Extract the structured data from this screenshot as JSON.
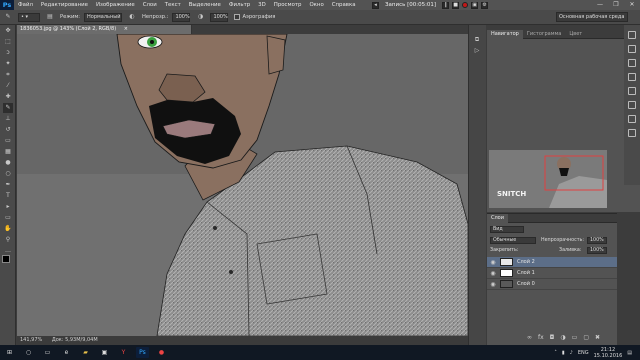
{
  "app": {
    "logo": "Ps"
  },
  "menu": [
    "Файл",
    "Редактирование",
    "Изображение",
    "Слои",
    "Текст",
    "Выделение",
    "Фильтр",
    "3D",
    "Просмотр",
    "Окно",
    "Справка"
  ],
  "recorder": {
    "label": "Запись [00:05:01]"
  },
  "window_controls": {
    "minimize": "—",
    "restore": "❐",
    "close": "✕"
  },
  "options": {
    "mode_label": "Режим:",
    "mode_value": "Нормальный",
    "opacity_label": "Непрозр.:",
    "opacity_value": "100%",
    "flow_value": "100%",
    "airbrush_label": "Аэрография",
    "workspace": "Основная рабочая среда"
  },
  "document": {
    "tab_title": "1836053.jpg @ 143% (Слой 2, RGB/8)",
    "close": "×",
    "status_zoom": "141,97%",
    "status_doc": "Док: 5,93M/9,04M"
  },
  "navigator": {
    "tabs": [
      "Навигатор",
      "Гистограмма",
      "Цвет"
    ],
    "thumb_text": "SNITCH",
    "zoom": "141,97%"
  },
  "layers": {
    "tabs": [
      "Слои"
    ],
    "kind_label": "Вид",
    "blend_mode": "Обычные",
    "opacity_label": "Непрозрачность:",
    "opacity_value": "100%",
    "lock_label": "Закрепить:",
    "fill_label": "Заливка:",
    "fill_value": "100%",
    "items": [
      {
        "name": "Слой 2",
        "selected": true
      },
      {
        "name": "Слой 1",
        "selected": false
      },
      {
        "name": "Слой 0",
        "selected": false
      }
    ]
  },
  "taskbar": {
    "lang": "ENG",
    "time": "21:12",
    "date": "15.10.2016"
  },
  "colors": {
    "skin": "#8a7060",
    "beard": "#101010",
    "lips": "#9a7a7c",
    "eye": "#3aa040",
    "shirt": "#9a9a9a",
    "selection_bar": "#5c6e88"
  }
}
